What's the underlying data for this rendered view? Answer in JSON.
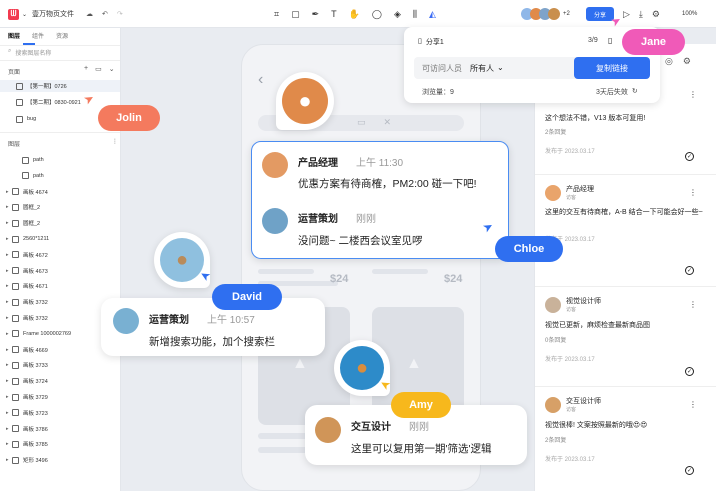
{
  "topbar": {
    "file_name": "壹万物页文件",
    "share_label": "分享",
    "zoom": "100%",
    "extra_users": "+2"
  },
  "left": {
    "tabs": [
      "图层",
      "组件",
      "资源"
    ],
    "search_placeholder": "搜索图层名称",
    "pages_title": "页面",
    "pages": [
      "【第一期】0726",
      "【第二期】0830-0921",
      "bug"
    ],
    "layers_title": "图层",
    "layers": [
      "path",
      "path",
      "画板 4674",
      "圆框_2",
      "圆框_2",
      "2560*1211",
      "画板 4672",
      "画板 4673",
      "画板 4671",
      "画板 3732",
      "画板 3732",
      "Frame 1000002769",
      "画板 4669",
      "画板 3733",
      "画板 3724",
      "画板 3729",
      "画板 3723",
      "画板 3786",
      "画板 3785",
      "矩形 3496"
    ]
  },
  "share": {
    "title": "分享1",
    "page_count": "3/9",
    "access_label": "可访问人员",
    "access_value": "所有人",
    "copy_button": "复制链接",
    "views_label": "浏览量：9",
    "expire_label": "3天后失效"
  },
  "chat_main": {
    "rows": [
      {
        "name": "产品经理",
        "time": "上午 11:30",
        "text": "优惠方案有待商榷，PM2:00 碰一下吧!"
      },
      {
        "name": "运营策划",
        "time": "刚刚",
        "text": "没问题~ 二楼西会议室见啰"
      }
    ]
  },
  "chat_david": {
    "name": "运营策划",
    "time": "上午 10:57",
    "text": "新增搜索功能，加个搜索栏"
  },
  "chat_amy": {
    "name": "交互设计",
    "time": "刚刚",
    "text": "这里可以复用第一期'筛选'逻辑"
  },
  "prices": [
    "$24",
    "$24"
  ],
  "tags": {
    "jolin": "Jolin",
    "jane": "Jane",
    "chloe": "Chloe",
    "david": "David",
    "amy": "Amy"
  },
  "comments": [
    {
      "name": "",
      "role": "",
      "text": "这个想法不错，V13 版本可复用!",
      "replies": "2条回复",
      "date": "发布于 2023.03.17"
    },
    {
      "name": "产品经理",
      "role": "访客",
      "text": "这里的交互有待商榷，A-B 结合一下可能会好一些~",
      "replies": "",
      "date": "发布于 2023.03.17"
    },
    {
      "name": "视觉设计师",
      "role": "访客",
      "text": "视觉已更新，麻烦检查最新商品图",
      "replies": "0条回复",
      "date": "发布于 2023.03.17"
    },
    {
      "name": "交互设计师",
      "role": "访客",
      "text": "视觉很棒! 文案按照最新的哦😍😍",
      "replies": "2条回复",
      "date": "发布于 2023.03.17"
    }
  ],
  "colors": {
    "blue": "#2f6ff0",
    "pink": "#f05ab8",
    "coral": "#f47a5e",
    "yellow": "#f7b81c"
  }
}
